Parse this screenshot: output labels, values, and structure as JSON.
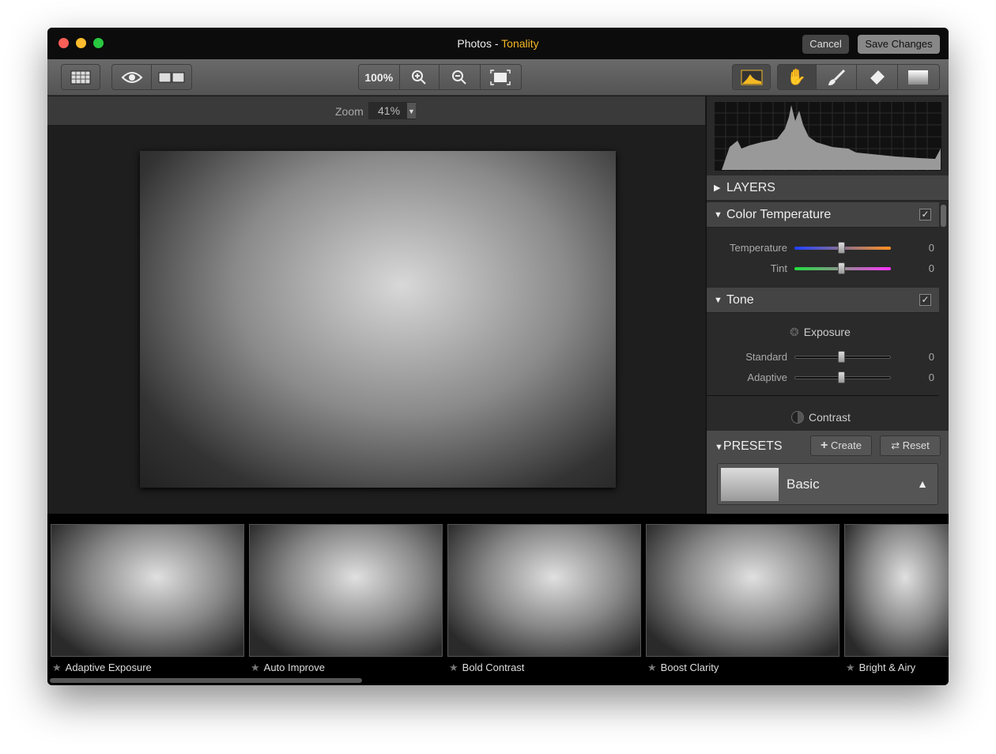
{
  "window": {
    "title_prefix": "Photos -",
    "title_app": "Tonality",
    "cancel": "Cancel",
    "save": "Save Changes",
    "accent": "#f4b824"
  },
  "toolbar": {
    "zoom_100": "100%",
    "icons": [
      "grid-view-icon",
      "eye-icon",
      "split-view-icon",
      "zoom-in-icon",
      "zoom-out-icon",
      "fit-screen-icon",
      "histogram-icon",
      "hand-icon",
      "brush-icon",
      "eraser-icon",
      "gradient-icon"
    ]
  },
  "zoom": {
    "label": "Zoom",
    "value": "41%"
  },
  "panel": {
    "layers": "LAYERS",
    "color_temperature": {
      "title": "Color Temperature",
      "checked": true,
      "temperature": {
        "label": "Temperature",
        "value": "0"
      },
      "tint": {
        "label": "Tint",
        "value": "0"
      }
    },
    "tone": {
      "title": "Tone",
      "checked": true,
      "exposure": "Exposure",
      "standard": {
        "label": "Standard",
        "value": "0"
      },
      "adaptive": {
        "label": "Adaptive",
        "value": "0"
      },
      "contrast": "Contrast"
    },
    "presets": {
      "title": "PRESETS",
      "create": "Create",
      "reset": "Reset",
      "selected": "Basic"
    }
  },
  "filmstrip": {
    "items": [
      {
        "label": "Adaptive Exposure"
      },
      {
        "label": "Auto Improve"
      },
      {
        "label": "Bold Contrast"
      },
      {
        "label": "Boost Clarity"
      },
      {
        "label": "Bright & Airy"
      }
    ]
  }
}
